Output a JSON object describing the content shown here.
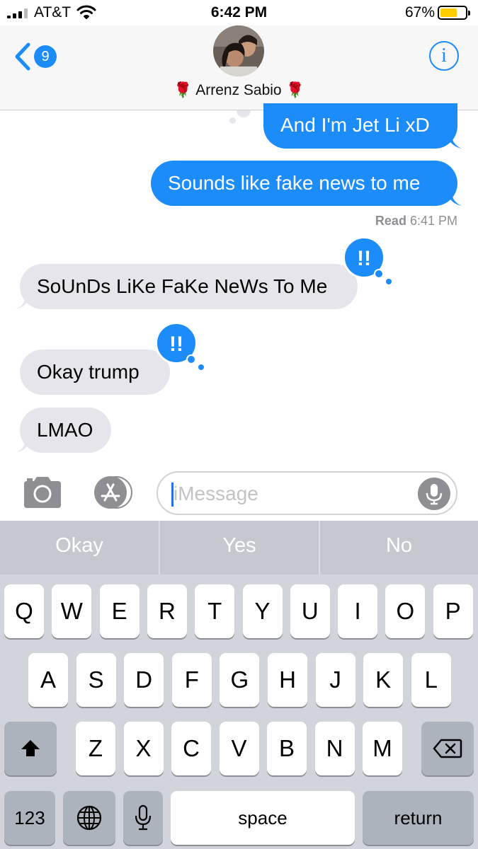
{
  "status_bar": {
    "carrier": "AT&T",
    "time": "6:42 PM",
    "battery_percent": "67%",
    "battery_level": 0.67,
    "battery_color": "#ffcc00"
  },
  "header": {
    "back_count": "9",
    "contact_name": "🌹 Arrenz Sabio 🌹",
    "info_label": "i"
  },
  "messages": [
    {
      "direction": "sent",
      "text": "And I'm Jet Li xD"
    },
    {
      "direction": "sent",
      "text": "Sounds like fake news to me"
    },
    {
      "direction": "received",
      "text": "SoUnDs LiKe FaKe NeWs To Me",
      "tapback": "!!"
    },
    {
      "direction": "received",
      "text": "Okay trump",
      "tapback": "!!"
    },
    {
      "direction": "received",
      "text": "LMAO"
    }
  ],
  "read_receipt": {
    "label": "Read",
    "time": "6:41 PM"
  },
  "input": {
    "placeholder": "iMessage",
    "value": ""
  },
  "predictions": [
    "Okay",
    "Yes",
    "No"
  ],
  "keyboard": {
    "row1": [
      "Q",
      "W",
      "E",
      "R",
      "T",
      "Y",
      "U",
      "I",
      "O",
      "P"
    ],
    "row2": [
      "A",
      "S",
      "D",
      "F",
      "G",
      "H",
      "J",
      "K",
      "L"
    ],
    "row3": [
      "Z",
      "X",
      "C",
      "V",
      "B",
      "N",
      "M"
    ],
    "numbers_label": "123",
    "space_label": "space",
    "return_label": "return"
  },
  "colors": {
    "accent": "#1b8cfa",
    "received_bubble": "#e6e5eb",
    "keyboard_bg": "#d1d4da"
  },
  "icons": [
    "signal-icon",
    "wifi-icon",
    "battery-icon",
    "back-chevron-icon",
    "info-icon",
    "camera-icon",
    "app-store-icon",
    "microphone-icon",
    "shift-icon",
    "backspace-icon",
    "globe-icon",
    "dictation-icon"
  ]
}
